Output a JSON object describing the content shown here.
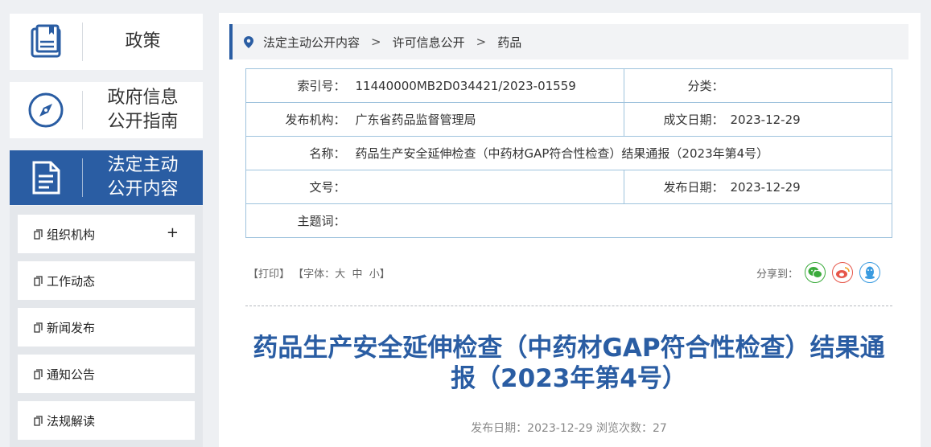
{
  "sidebar": {
    "cards": [
      {
        "label": "政策",
        "icon": "policy-book-icon"
      },
      {
        "label": "政府信息\n公开指南",
        "icon": "compass-icon"
      },
      {
        "label": "法定主动\n公开内容",
        "icon": "document-icon"
      }
    ],
    "items": [
      {
        "label": "组织机构",
        "expand": "+"
      },
      {
        "label": "工作动态"
      },
      {
        "label": "新闻发布"
      },
      {
        "label": "通知公告"
      },
      {
        "label": "法规解读"
      }
    ]
  },
  "breadcrumb": [
    "法定主动公开内容",
    "许可信息公开",
    "药品"
  ],
  "meta": {
    "index_label": "索引号：",
    "index_value": "11440000MB2D034421/2023-01559",
    "category_label": "分类：",
    "category_value": "",
    "issuer_label": "发布机构：",
    "issuer_value": "广东省药品监督管理局",
    "written_date_label": "成文日期：",
    "written_date_value": "2023-12-29",
    "name_label": "名称：",
    "name_value": "药品生产安全延伸检查（中药材GAP符合性检查）结果通报（2023年第4号）",
    "doc_no_label": "文号：",
    "doc_no_value": "",
    "publish_date_label": "发布日期：",
    "publish_date_value": "2023-12-29",
    "subject_label": "主题词：",
    "subject_value": ""
  },
  "tools": {
    "print": "【打印】",
    "font_prefix": "【字体：",
    "font_large": "大",
    "font_medium": "中",
    "font_small": "小",
    "font_suffix": "】"
  },
  "share": {
    "label": "分享到："
  },
  "article": {
    "title": "药品生产安全延伸检查（中药材GAP符合性检查）结果通报（2023年第4号）",
    "publish_info": "发布日期：2023-12-29  浏览次数：27"
  },
  "colors": {
    "accent": "#2a5da3",
    "border": "#9fc3dd"
  }
}
